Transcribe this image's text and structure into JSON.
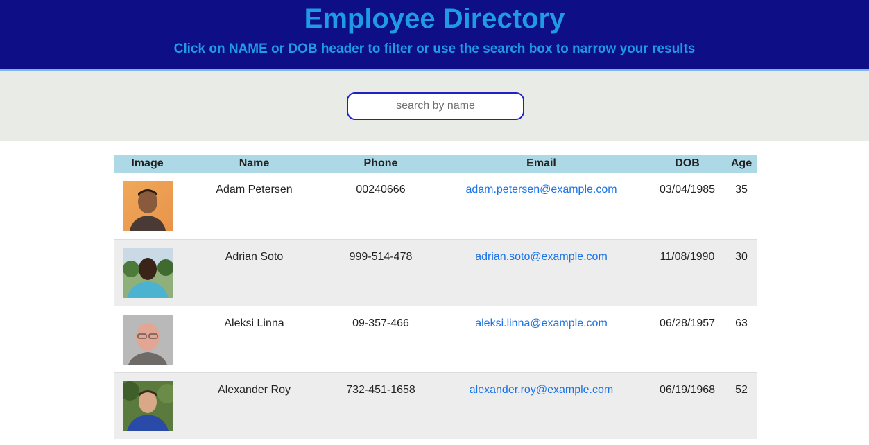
{
  "header": {
    "title": "Employee Directory",
    "subtitle": "Click on NAME or DOB header to filter or use the search box to narrow your results"
  },
  "search": {
    "placeholder": "search by name",
    "value": ""
  },
  "table": {
    "columns": [
      "Image",
      "Name",
      "Phone",
      "Email",
      "DOB",
      "Age"
    ],
    "rows": [
      {
        "name": "Adam Petersen",
        "phone": "00240666",
        "email": "adam.petersen@example.com",
        "dob": "03/04/1985",
        "age": "35",
        "avatar": "portrait-man-orange-background"
      },
      {
        "name": "Adrian Soto",
        "phone": "999-514-478",
        "email": "adrian.soto@example.com",
        "dob": "11/08/1990",
        "age": "30",
        "avatar": "portrait-man-outdoor-trees"
      },
      {
        "name": "Aleksi Linna",
        "phone": "09-357-466",
        "email": "aleksi.linna@example.com",
        "dob": "06/28/1957",
        "age": "63",
        "avatar": "portrait-man-glasses-grey-background"
      },
      {
        "name": "Alexander Roy",
        "phone": "732-451-1658",
        "email": "alexander.roy@example.com",
        "dob": "06/19/1968",
        "age": "52",
        "avatar": "portrait-man-blue-shirt-garden"
      }
    ]
  },
  "colors": {
    "header_bg": "#0e0f87",
    "header_text": "#1e9be3",
    "header_border": "#7fb5ee",
    "search_band_bg": "#e9ece6",
    "search_border": "#2020c8",
    "table_header_bg": "#add8e6",
    "row_alt_bg": "#ededed",
    "link": "#1a73e8"
  }
}
